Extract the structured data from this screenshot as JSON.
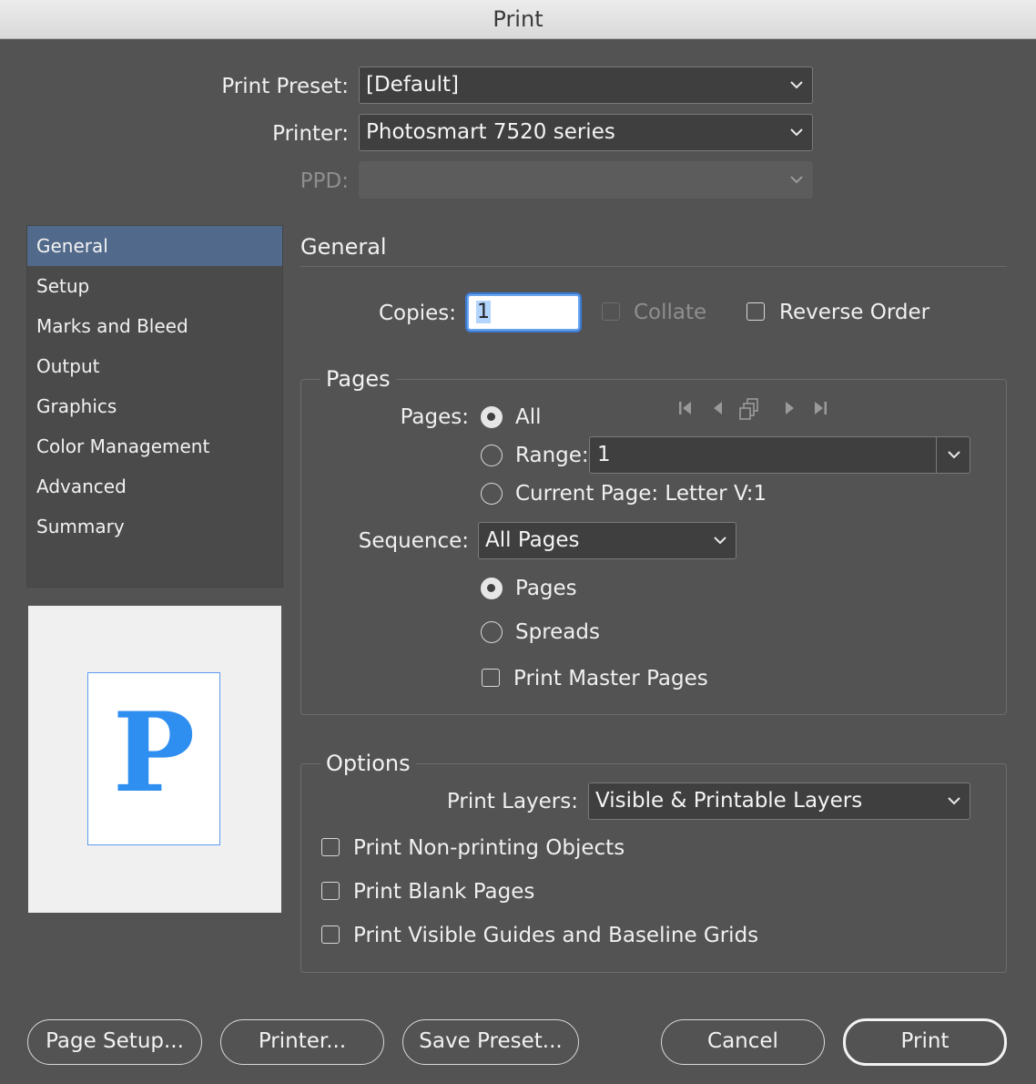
{
  "window": {
    "title": "Print"
  },
  "top": {
    "print_preset_label": "Print Preset:",
    "print_preset_value": "[Default]",
    "printer_label": "Printer:",
    "printer_value": "Photosmart 7520 series",
    "ppd_label": "PPD:",
    "ppd_value": ""
  },
  "sidebar": {
    "items": [
      {
        "label": "General",
        "selected": true
      },
      {
        "label": "Setup"
      },
      {
        "label": "Marks and Bleed"
      },
      {
        "label": "Output"
      },
      {
        "label": "Graphics"
      },
      {
        "label": "Color Management"
      },
      {
        "label": "Advanced"
      },
      {
        "label": "Summary"
      }
    ]
  },
  "preview": {
    "glyph": "P",
    "accent": "#2f8ff0"
  },
  "general": {
    "title": "General",
    "copies_label": "Copies:",
    "copies_value": "1",
    "collate_label": "Collate",
    "collate_checked": false,
    "reverse_label": "Reverse Order",
    "reverse_checked": false
  },
  "pages": {
    "group_title": "Pages",
    "pages_label": "Pages:",
    "all_label": "All",
    "range_label": "Range:",
    "range_value": "1",
    "current_label": "Current Page: Letter V:1",
    "selected_option": "All",
    "sequence_label": "Sequence:",
    "sequence_value": "All Pages",
    "pages_option": "Pages",
    "spreads_option": "Spreads",
    "layout_selected": "Pages",
    "print_master_label": "Print Master Pages",
    "nav_icons": [
      "first-page-icon",
      "previous-page-icon",
      "pages-icon",
      "next-page-icon",
      "last-page-icon"
    ]
  },
  "options": {
    "group_title": "Options",
    "layers_label": "Print Layers:",
    "layers_value": "Visible & Printable Layers",
    "non_printing_label": "Print Non-printing Objects",
    "blank_pages_label": "Print Blank Pages",
    "guides_label": "Print Visible Guides and Baseline Grids"
  },
  "buttons": {
    "page_setup": "Page Setup...",
    "printer": "Printer...",
    "save_preset": "Save Preset...",
    "cancel": "Cancel",
    "print": "Print"
  }
}
